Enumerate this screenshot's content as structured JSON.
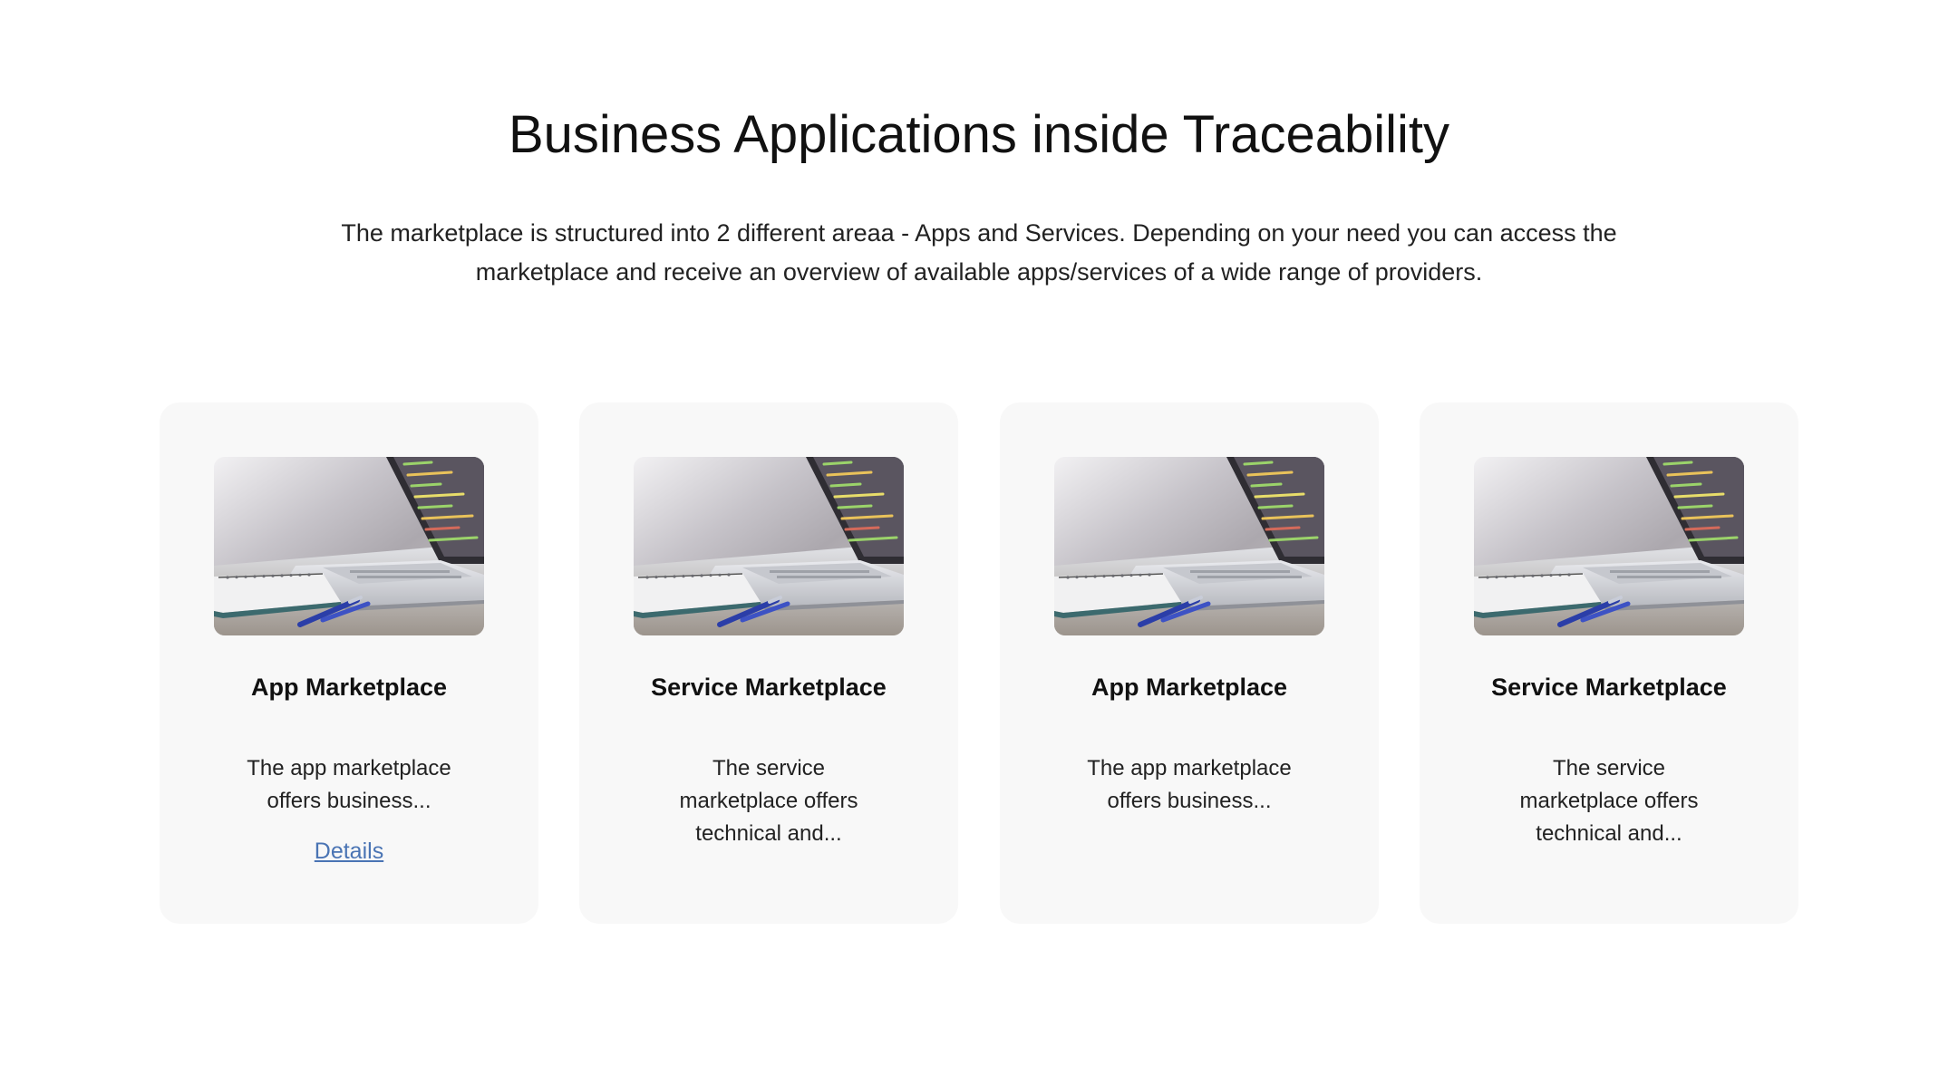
{
  "header": {
    "title": "Business Applications inside Traceability",
    "description": "The marketplace is structured into 2 different areaa - Apps and Services. Depending on your need you can access the marketplace and receive an overview of available apps/services of a wide range of providers."
  },
  "cards": [
    {
      "image": "laptop-notebook-photo",
      "title": "App Marketplace",
      "description": "The app marketplace offers business...",
      "link": "Details"
    },
    {
      "image": "laptop-notebook-photo",
      "title": "Service Marketplace",
      "description": "The service marketplace offers technical and...",
      "link": null
    },
    {
      "image": "laptop-notebook-photo",
      "title": "App Marketplace",
      "description": "The app marketplace offers business...",
      "link": null
    },
    {
      "image": "laptop-notebook-photo",
      "title": "Service Marketplace",
      "description": "The service marketplace offers technical and...",
      "link": null
    }
  ],
  "colors": {
    "card_background": "#f8f8f8",
    "link": "#4a74b4",
    "text": "#111111"
  }
}
